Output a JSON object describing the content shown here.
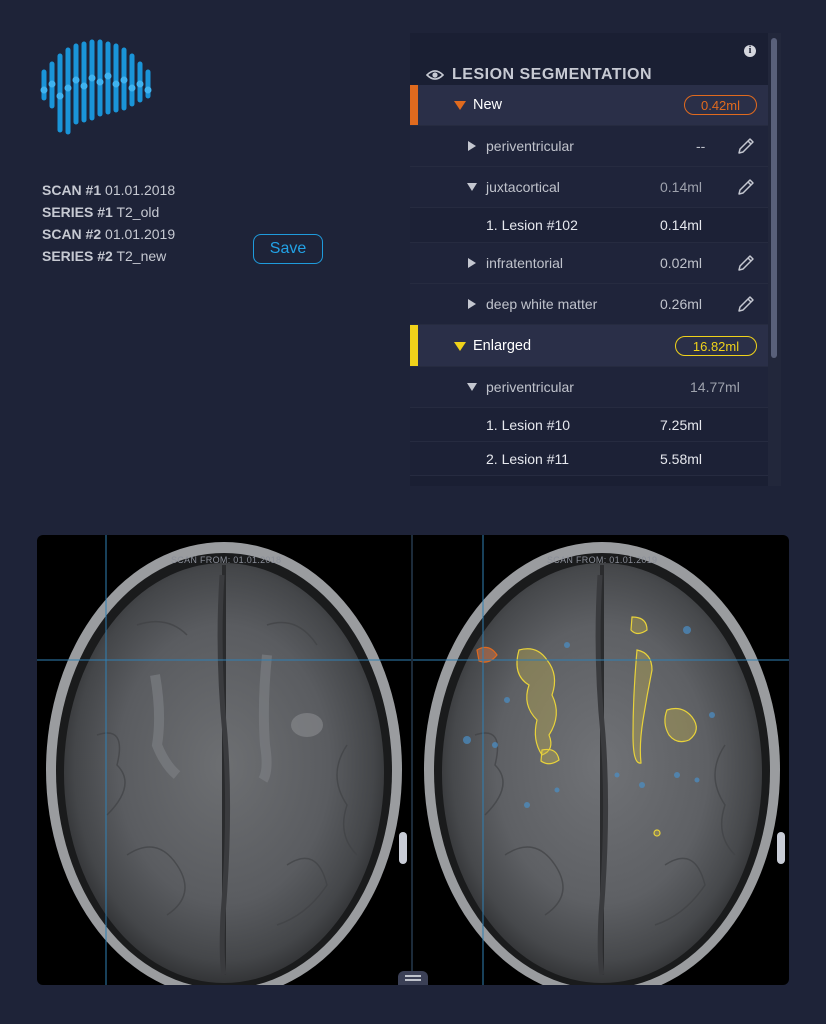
{
  "scan_info": [
    {
      "label": "SCAN #1",
      "value": "01.01.2018"
    },
    {
      "label": "SERIES #1",
      "value": "T2_old"
    },
    {
      "label": "SCAN #2",
      "value": "01.01.2019"
    },
    {
      "label": "SERIES #2",
      "value": "T2_new"
    }
  ],
  "save_label": "Save",
  "panel": {
    "title": "LESION SEGMENTATION",
    "info_glyph": "i",
    "new": {
      "label": "New",
      "total": "0.42ml",
      "color": "#e06a1e"
    },
    "new_rows": {
      "periventricular": {
        "label": "periventricular",
        "value": "--"
      },
      "juxtacortical": {
        "label": "juxtacortical",
        "value": "0.14ml"
      },
      "lesion102": {
        "label": "1. Lesion #102",
        "value": "0.14ml"
      },
      "infratentorial": {
        "label": "infratentorial",
        "value": "0.02ml"
      },
      "deep_white_matter": {
        "label": "deep white matter",
        "value": "0.26ml"
      }
    },
    "enlarged": {
      "label": "Enlarged",
      "total": "16.82ml",
      "color": "#f0d21a"
    },
    "enlarged_rows": {
      "periventricular": {
        "label": "periventricular",
        "value": "14.77ml"
      },
      "lesion10": {
        "label": "1. Lesion #10",
        "value": "7.25ml"
      },
      "lesion11": {
        "label": "2. Lesion #11",
        "value": "5.58ml"
      }
    }
  },
  "viewer": {
    "left_scan_label": "SCAN FROM: 01.01.2018",
    "right_scan_label": "SCAN FROM: 01.01.2019"
  },
  "colors": {
    "accent_blue": "#1f9bdc",
    "new_orange": "#e06a1e",
    "enlarged_yellow": "#f0d21a",
    "background": "#1e2338"
  }
}
